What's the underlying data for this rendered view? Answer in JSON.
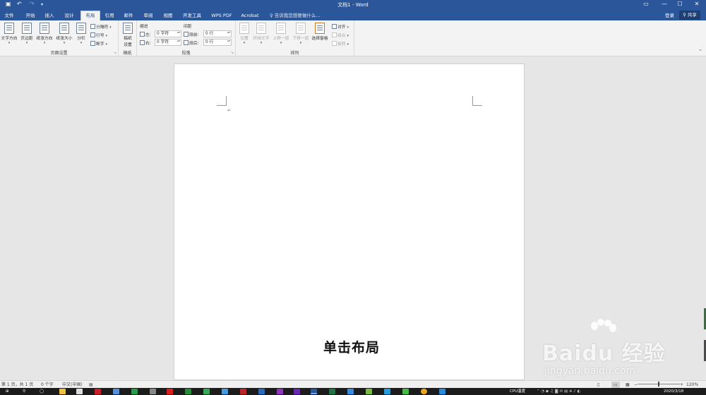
{
  "titlebar": {
    "title": "文档1 - Word",
    "save_icon": "save-icon",
    "undo_icon": "undo-icon",
    "redo_icon": "redo-icon",
    "customize_icon": "customize-icon",
    "ribbon_display_icon": "ribbon-display-icon",
    "minimize_icon": "minimize-icon",
    "maximize_icon": "maximize-icon",
    "close_icon": "close-icon"
  },
  "tabs": [
    {
      "label": "文件"
    },
    {
      "label": "开始"
    },
    {
      "label": "插入"
    },
    {
      "label": "设计"
    },
    {
      "label": "布局",
      "active": true
    },
    {
      "label": "引用"
    },
    {
      "label": "邮件"
    },
    {
      "label": "审阅"
    },
    {
      "label": "视图"
    },
    {
      "label": "开发工具"
    },
    {
      "label": "WPS PDF"
    },
    {
      "label": "Acrobat"
    }
  ],
  "tell_me": "告诉我您想要做什么...",
  "login": "登录",
  "share": "共享",
  "ribbon": {
    "page_setup": {
      "label": "页面设置",
      "text_direction": "文字方向",
      "margins": "页边距",
      "orientation": "纸张方向",
      "size": "纸张大小",
      "columns": "分栏",
      "breaks": "分隔符",
      "line_numbers": "行号",
      "hyphenation": "断字"
    },
    "draft_paper": {
      "label": "稿纸",
      "button_line1": "稿纸",
      "button_line2": "设置"
    },
    "paragraph": {
      "label": "段落",
      "indent_head": "缩进",
      "spacing_head": "间距",
      "left_label": "左:",
      "left_value": "0 字符",
      "right_label": "右:",
      "right_value": "0 字符",
      "before_label": "段前:",
      "before_value": "0 行",
      "after_label": "段后:",
      "after_value": "0 行"
    },
    "arrange": {
      "label": "排列",
      "position": "位置",
      "wrap_text": "环绕文字",
      "bring_forward": "上移一层",
      "send_backward": "下移一层",
      "selection_pane": "选择窗格",
      "align": "对齐",
      "group": "组合",
      "rotate": "旋转"
    }
  },
  "document": {
    "caption": "单击布局"
  },
  "watermark": {
    "brand": "Bai",
    "brand2": "du",
    "brand3": "经验",
    "url": "jingyan.baidu.com"
  },
  "statusbar": {
    "page_count": "第 1 页，共 1 页",
    "word_count": "0 个字",
    "language": "中文(中国)",
    "zoom": "120%",
    "zoom_minus": "−",
    "zoom_plus": "+"
  },
  "taskbar": {
    "cpu_label": "CPU温度",
    "date": "2020/3/18"
  },
  "colors": {
    "word_blue": "#2b579a",
    "ribbon_bg": "#f3f3f3",
    "canvas_bg": "#e6e6e6"
  }
}
